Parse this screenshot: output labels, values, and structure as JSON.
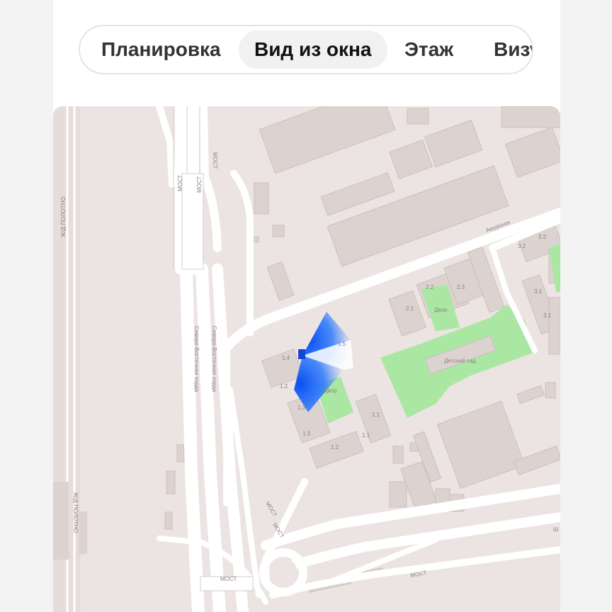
{
  "tabs": [
    {
      "label": "Планировка",
      "active": false
    },
    {
      "label": "Вид из окна",
      "active": true
    },
    {
      "label": "Этаж",
      "active": false
    },
    {
      "label": "Визу",
      "active": false
    }
  ],
  "map": {
    "streets": {
      "amurskaya": "Амурская",
      "sv_horda_1": "Северо-Восточная хорда",
      "sv_horda_2": "Северо-Восточная хорда",
      "zhd_1": "Ж/Д ПОЛОТНО",
      "zhd_2": "Ж/Д ПОЛОТНО",
      "most_1": "МОСТ",
      "most_2": "МОСТ",
      "most_3": "МОСТ",
      "most_4": "МОСТ",
      "most_5": "МОСТ",
      "most_6": "МОСТ",
      "most_7": "МОСТ",
      "edge": "Ш"
    },
    "areas": {
      "dvor_1": "Двор",
      "dvor_2": "Двор",
      "detsad": "Детский сад"
    },
    "buildings": [
      "1.4",
      "1.5",
      "1.2",
      "1.3",
      "1.3",
      "1.2",
      "1.1",
      "1.1",
      "2.1",
      "2.2",
      "2.3",
      "3.2",
      "3.2",
      "3.1",
      "3.1"
    ],
    "colors": {
      "background": "#ece4e2",
      "building": "#dcd2cf",
      "road": "#ffffff",
      "green": "#a9e7a3",
      "view_cone": "#1b66f5"
    }
  }
}
